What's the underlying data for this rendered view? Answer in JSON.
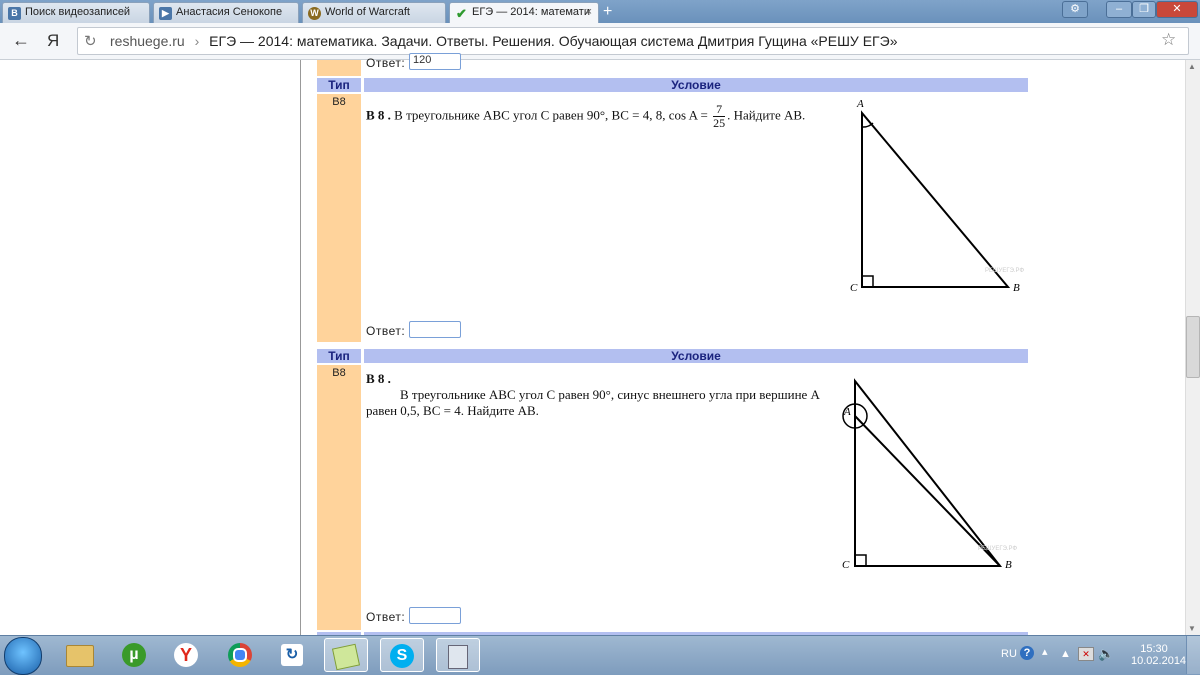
{
  "browser": {
    "tabs": [
      {
        "label": "Поиск видеозаписей",
        "favicon": "vk-icon",
        "color": "#4a76a8"
      },
      {
        "label": "Анастасия Сенокопе",
        "favicon": "vk-video-icon",
        "color": "#4a76a8"
      },
      {
        "label": "World of Warcraft",
        "favicon": "wow-icon",
        "color": "#8a6a1f"
      },
      {
        "label": "ЕГЭ — 2014: математи",
        "favicon": "check-icon",
        "color": "#3aa23a"
      }
    ],
    "new_tab": "+",
    "tab_close": "×",
    "address": {
      "host": "reshuege.ru",
      "separator": "›",
      "title": "ЕГЭ — 2014: математика. Задачи. Ответы. Решения. Обучающая система Дмитрия Гущина «РЕШУ ЕГЭ»"
    },
    "back_icon": "←",
    "yandex_logo": "Я",
    "star_icon": "☆"
  },
  "page": {
    "prev_answer_label": "Ответ:",
    "prev_answer_value": "120",
    "col_type": "Тип",
    "col_condition": "Условие",
    "tasks": [
      {
        "type": "B8",
        "num": "B 8 .",
        "text_1": "В треугольнике ABC угол C равен 90°, BC = 4, 8, cos A =",
        "frac_num": "7",
        "frac_den": "25",
        "text_2": ". Найдите AB.",
        "answer_label": "Ответ:",
        "labels": {
          "a": "A",
          "b": "B",
          "c": "C"
        },
        "watermark": "РЕШУЕГЭ.РФ"
      },
      {
        "type": "B8",
        "num": "B 8 .",
        "text_1": "В треугольнике ABC угол C равен 90°, синус внешнего угла при вершине A",
        "text_2": "равен 0,5, BC = 4. Найдите AB.",
        "answer_label": "Ответ:",
        "labels": {
          "a": "A",
          "b": "B",
          "c": "C"
        },
        "watermark": "РЕШУЕГЭ.РФ"
      }
    ]
  },
  "taskbar": {
    "lang": "RU",
    "time": "15:30",
    "date": "10.02.2014",
    "icons": [
      "windows-start-icon",
      "explorer-icon",
      "utorrent-icon",
      "yandex-icon",
      "chrome-icon",
      "app-icon",
      "notes-icon",
      "skype-icon",
      "calculator-icon"
    ]
  }
}
